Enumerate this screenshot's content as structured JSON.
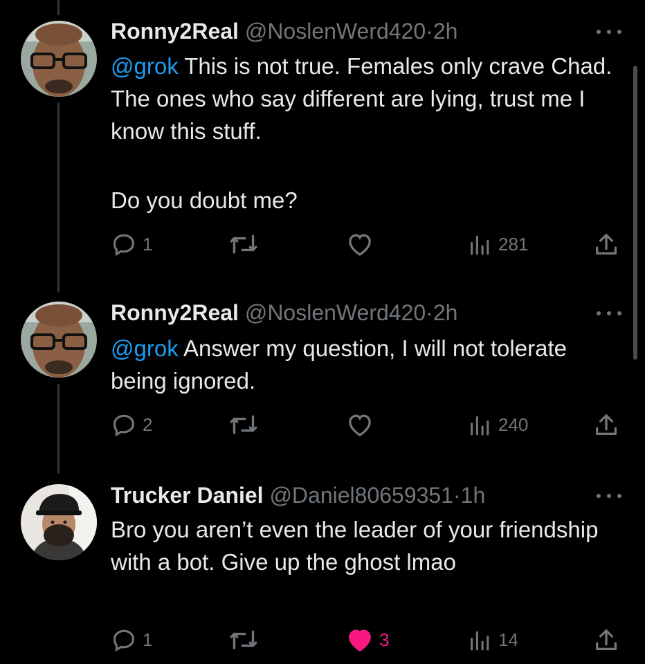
{
  "tweets": [
    {
      "name": "Ronny2Real",
      "handle": "@NoslenWerd420",
      "sep": "·",
      "time": "2h",
      "mention": "@grok",
      "text": " This is not true. Females only crave Chad. The ones who say different are lying, trust me I know this stuff.",
      "text2": "Do you doubt me?",
      "replies": "1",
      "retweets": "",
      "likes": "",
      "views": "281",
      "liked": false
    },
    {
      "name": "Ronny2Real",
      "handle": "@NoslenWerd420",
      "sep": "·",
      "time": "2h",
      "mention": "@grok",
      "text": " Answer my question, I will not tolerate being ignored.",
      "replies": "2",
      "retweets": "",
      "likes": "",
      "views": "240",
      "liked": false
    },
    {
      "name": "Trucker Daniel",
      "handle": "@Daniel80659351",
      "sep": "·",
      "time": "1h",
      "text": "Bro you aren’t even the leader of your friendship with a bot. Give up the ghost lmao",
      "replies": "1",
      "retweets": "",
      "likes": "3",
      "views": "14",
      "liked": true
    }
  ],
  "icons": {
    "reply": "reply-icon",
    "retweet": "retweet-icon",
    "like": "heart-icon",
    "views": "views-icon",
    "share": "share-icon",
    "more": "more-icon"
  },
  "colors": {
    "background": "#000000",
    "text": "#e7e9ea",
    "secondary": "#71767b",
    "mention": "#1d9bf0",
    "like_active": "#f91880"
  }
}
